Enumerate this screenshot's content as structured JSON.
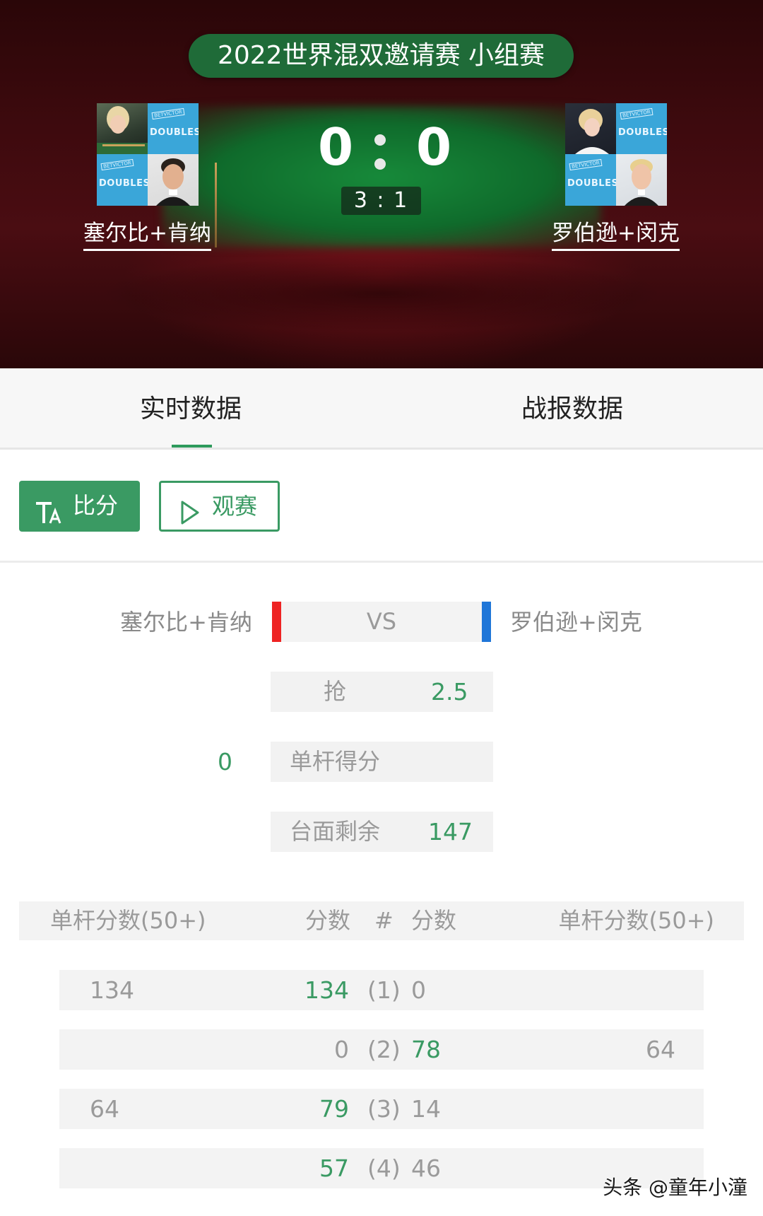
{
  "header": {
    "event_title": "2022世界混双邀请赛 小组赛",
    "team_a": {
      "name": "塞尔比+肯纳",
      "logo_text": "DOUBLES",
      "logo_mini": "BETVICTOR"
    },
    "team_b": {
      "name": "罗伯逊+闵克",
      "logo_text": "DOUBLES",
      "logo_mini": "BETVICTOR"
    },
    "score_a": "0",
    "score_b": "0",
    "frames": "3 : 1"
  },
  "tabs": [
    {
      "label": "实时数据",
      "active": true
    },
    {
      "label": "战报数据",
      "active": false
    }
  ],
  "buttons": {
    "score_label": "比分",
    "watch_label": "观赛"
  },
  "live": {
    "left_name": "塞尔比+肯纳",
    "right_name": "罗伯逊+闵克",
    "vs": "VS",
    "left_color": "#ee2323",
    "right_color": "#1f76d8",
    "stats": [
      {
        "label": "抢",
        "left_value": "",
        "value": "2.5"
      },
      {
        "label": "单杆得分",
        "left_value": "0",
        "value": ""
      },
      {
        "label": "台面剩余",
        "left_value": "",
        "value": "147"
      }
    ]
  },
  "frames_table": {
    "headers": {
      "left_breaks": "单杆分数(50+)",
      "left_score": "分数",
      "frame_no": "#",
      "right_score": "分数",
      "right_breaks": "单杆分数(50+)"
    },
    "rows": [
      {
        "left_break": "134",
        "left_score": "134",
        "frame": "(1)",
        "right_score": "0",
        "right_break": "",
        "winner": "left"
      },
      {
        "left_break": "",
        "left_score": "0",
        "frame": "(2)",
        "right_score": "78",
        "right_break": "64",
        "winner": "right"
      },
      {
        "left_break": "64",
        "left_score": "79",
        "frame": "(3)",
        "right_score": "14",
        "right_break": "",
        "winner": "left"
      },
      {
        "left_break": "",
        "left_score": "57",
        "frame": "(4)",
        "right_score": "46",
        "right_break": "",
        "winner": "left"
      }
    ]
  },
  "watermark": "头条 @童年小潼",
  "theme": {
    "accent": "#3a9a63",
    "header_bg": "#3e0a0e",
    "pill_bg": "#1f6b38"
  }
}
